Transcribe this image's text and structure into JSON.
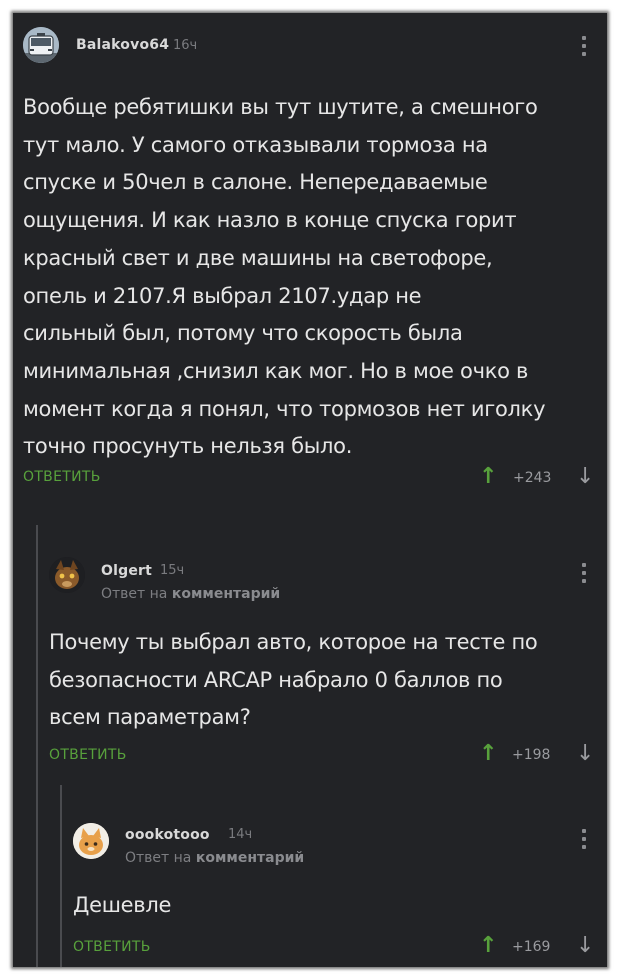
{
  "comments": [
    {
      "username": "Balakovo64",
      "time": "16ч",
      "text": "Вообще ребятишки вы тут шутите, а смешного\nтут мало. У самого отказывали тормоза на\nспуске и 50чел в салоне. Непередаваемые\nощущения. И как назло в конце спуска горит\nкрасный свет и две машины на светофоре,\nопель и 2107.Я выбрал 2107.удар не\nсильный был, потому что скорость была\nминимальная ,снизил как мог. Но в мое очко в\nмомент когда я понял, что тормозов нет иголку\nточно просунуть нельзя было.",
      "reply_label": "ОТВЕТИТЬ",
      "vote_up_icon": "arrow-up-icon",
      "rating": "+243",
      "vote_down_icon": "arrow-down-icon",
      "avatar_icon": "bus-avatar"
    },
    {
      "username": "Olgert",
      "time": "15ч",
      "reply_to_prefix": "Ответ на",
      "reply_to_target": "комментарий",
      "text": "Почему ты выбрал авто, которое на тесте по\nбезопасности ARCAP набрало 0 баллов по\nвсем параметрам?",
      "reply_label": "ОТВЕТИТЬ",
      "rating": "+198",
      "avatar_icon": "animal-avatar"
    },
    {
      "username": "oookotooo",
      "time": "14ч",
      "reply_to_prefix": "Ответ на",
      "reply_to_target": "комментарий",
      "text": "Дешевле",
      "reply_label": "ОТВЕТИТЬ",
      "rating": "+169",
      "avatar_icon": "cat-avatar"
    }
  ],
  "colors": {
    "background": "#222326",
    "accent_green": "#58a13c",
    "text": "#e6e6e6",
    "muted": "#7a7b7f"
  }
}
